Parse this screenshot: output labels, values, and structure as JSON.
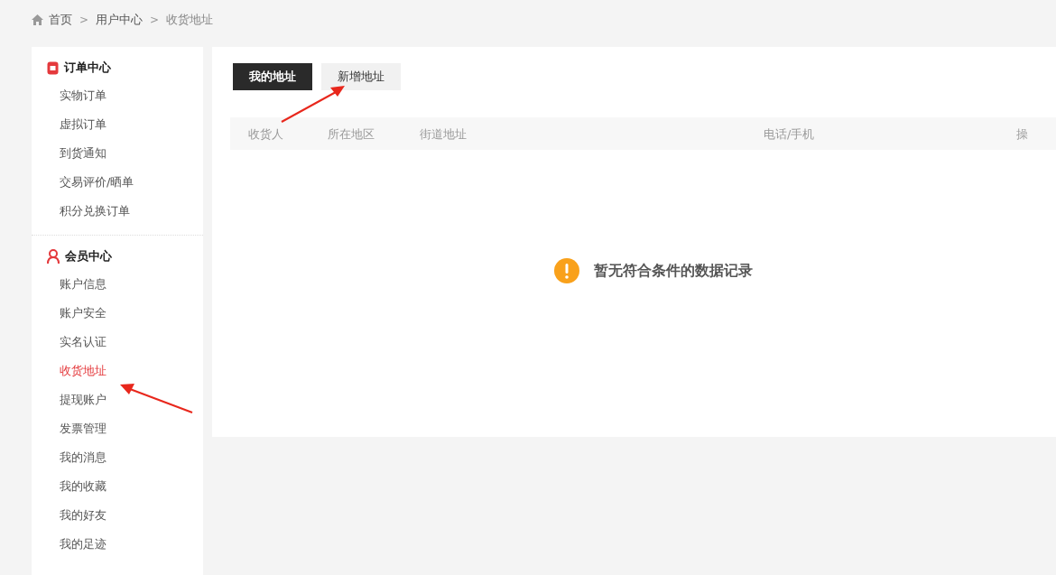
{
  "breadcrumb": [
    {
      "label": "首页",
      "kind": "home"
    },
    {
      "label": "用户中心",
      "kind": "link"
    },
    {
      "label": "收货地址",
      "kind": "current"
    }
  ],
  "breadcrumb_separator": ">",
  "sidebar": [
    {
      "title": "订单中心",
      "kind": "orders",
      "items": [
        {
          "label": "实物订单",
          "selected": false
        },
        {
          "label": "虚拟订单",
          "selected": false
        },
        {
          "label": "到货通知",
          "selected": false
        },
        {
          "label": "交易评价/晒单",
          "selected": false
        },
        {
          "label": "积分兑换订单",
          "selected": false
        }
      ]
    },
    {
      "title": "会员中心",
      "kind": "member",
      "items": [
        {
          "label": "账户信息",
          "selected": false
        },
        {
          "label": "账户安全",
          "selected": false
        },
        {
          "label": "实名认证",
          "selected": false
        },
        {
          "label": "收货地址",
          "selected": true
        },
        {
          "label": "提现账户",
          "selected": false
        },
        {
          "label": "发票管理",
          "selected": false
        },
        {
          "label": "我的消息",
          "selected": false
        },
        {
          "label": "我的收藏",
          "selected": false
        },
        {
          "label": "我的好友",
          "selected": false
        },
        {
          "label": "我的足迹",
          "selected": false
        }
      ]
    }
  ],
  "tabs": [
    {
      "label": "我的地址",
      "selected": true
    },
    {
      "label": "新增地址",
      "selected": false
    }
  ],
  "table": {
    "columns": [
      "收货人",
      "所在地区",
      "街道地址",
      "电话/手机",
      "操"
    ]
  },
  "empty_message": "暂无符合条件的数据记录"
}
